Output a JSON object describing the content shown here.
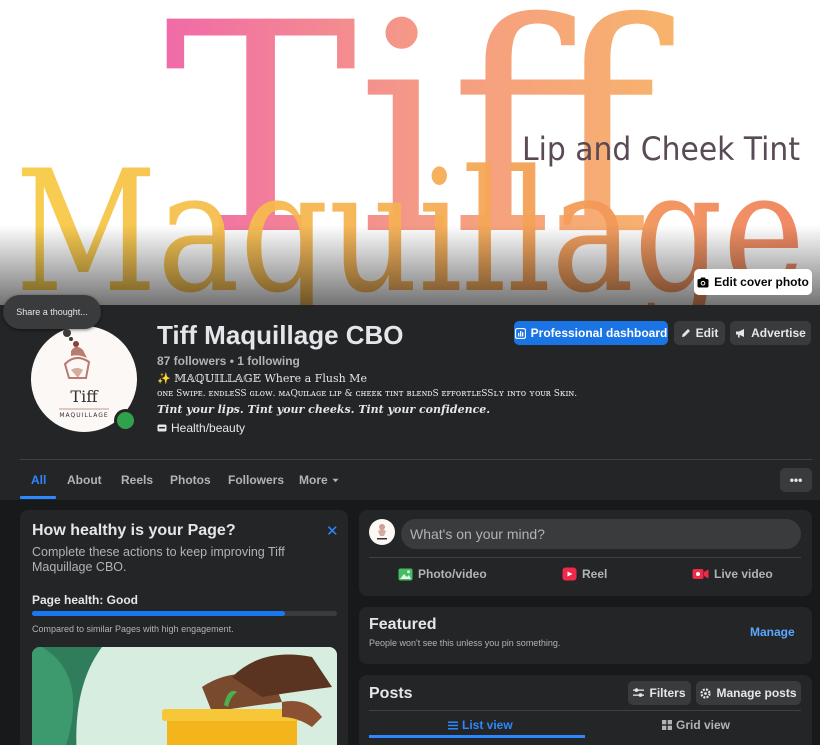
{
  "cover": {
    "brand_top": "Tiff",
    "brand_main": "Maquillage",
    "tagline": "Lip and Cheek Tint",
    "edit_label": "Edit cover photo"
  },
  "thought_bubble": "Share a thought...",
  "profile": {
    "avatar_text": "Tiff",
    "avatar_subtext": "MAQUILLAGE",
    "name": "Tiff Maquillage CBO",
    "follow_line": "87 followers • 1 following",
    "bio_line1": "✨ 𝕄𝔸ℚ𝕌𝕀𝕃𝕃𝔸𝔾𝔼 Where a Flush Me",
    "bio_line2": "ᴏɴᴇ Sᴡɪᴘᴇ. ᴇɴᴅʟᴇSS ɢʟᴏᴡ. ᴍᴀQᴜɪʟᴀɢᴇ ʟɪᴘ & ᴄʜᴇᴇᴋ ᴛɪɴᴛ ʙʟᴇɴᴅS ᴇꜰꜰᴏʀᴛʟᴇSSʟʏ ɪɴᴛᴏ ʏᴏᴜʀ Sᴋɪɴ.",
    "bio_line3": "𝑻𝒊𝒏𝒕 𝒚𝒐𝒖𝒓 𝒍𝒊𝒑𝒔. 𝑻𝒊𝒏𝒕 𝒚𝒐𝒖𝒓 𝒄𝒉𝒆𝒆𝒌𝒔. 𝑻𝒊𝒏𝒕 𝒚𝒐𝒖𝒓 𝒄𝒐𝒏𝒇𝒊𝒅𝒆𝒏𝒄𝒆.",
    "category": "Health/beauty"
  },
  "actions": {
    "dashboard": "Professional dashboard",
    "edit": "Edit",
    "advertise": "Advertise"
  },
  "tabs": [
    {
      "label": "All"
    },
    {
      "label": "About"
    },
    {
      "label": "Reels"
    },
    {
      "label": "Photos"
    },
    {
      "label": "Followers"
    },
    {
      "label": "More"
    }
  ],
  "more_dots": "•••",
  "health": {
    "title": "How healthy is your Page?",
    "description": "Complete these actions to keep improving Tiff Maquillage CBO.",
    "status": "Page health: Good",
    "progress": 0.83,
    "note": "Compared to similar Pages with high engagement."
  },
  "composer": {
    "placeholder": "What's on your mind?",
    "photo_video": "Photo/video",
    "reel": "Reel",
    "live_video": "Live video"
  },
  "featured": {
    "title": "Featured",
    "subtitle": "People won't see this unless you pin something.",
    "manage": "Manage"
  },
  "posts": {
    "title": "Posts",
    "filters": "Filters",
    "manage_posts": "Manage posts",
    "list_view": "List view",
    "grid_view": "Grid view"
  },
  "colors": {
    "accent": "#1b74e4",
    "link": "#2d88ff",
    "online": "#31a24c",
    "card_bg": "#242526",
    "page_bg": "#18191a"
  }
}
